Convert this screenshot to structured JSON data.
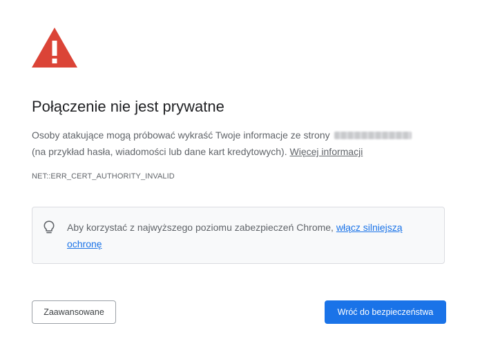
{
  "interstitial": {
    "title": "Połączenie nie jest prywatne",
    "description_line1": "Osoby atakujące mogą próbować wykraść Twoje informacje ze strony",
    "description_line2": "(na przykład hasła, wiadomości lub dane kart kredytowych).",
    "learn_more_link": "Więcej informacji",
    "error_code": "NET::ERR_CERT_AUTHORITY_INVALID",
    "warning_icon": "warning-triangle-icon",
    "accent_colors": {
      "warning": "#db4437",
      "primary_button": "#1a73e8",
      "link": "#1a73e8"
    }
  },
  "enhanced_protection": {
    "icon": "lightbulb-icon",
    "text": "Aby korzystać z najwyższego poziomu zabezpieczeń Chrome,",
    "link_text": "włącz silniejszą ochronę"
  },
  "buttons": {
    "advanced_label": "Zaawansowane",
    "back_to_safety_label": "Wróć do bezpieczeństwa"
  }
}
